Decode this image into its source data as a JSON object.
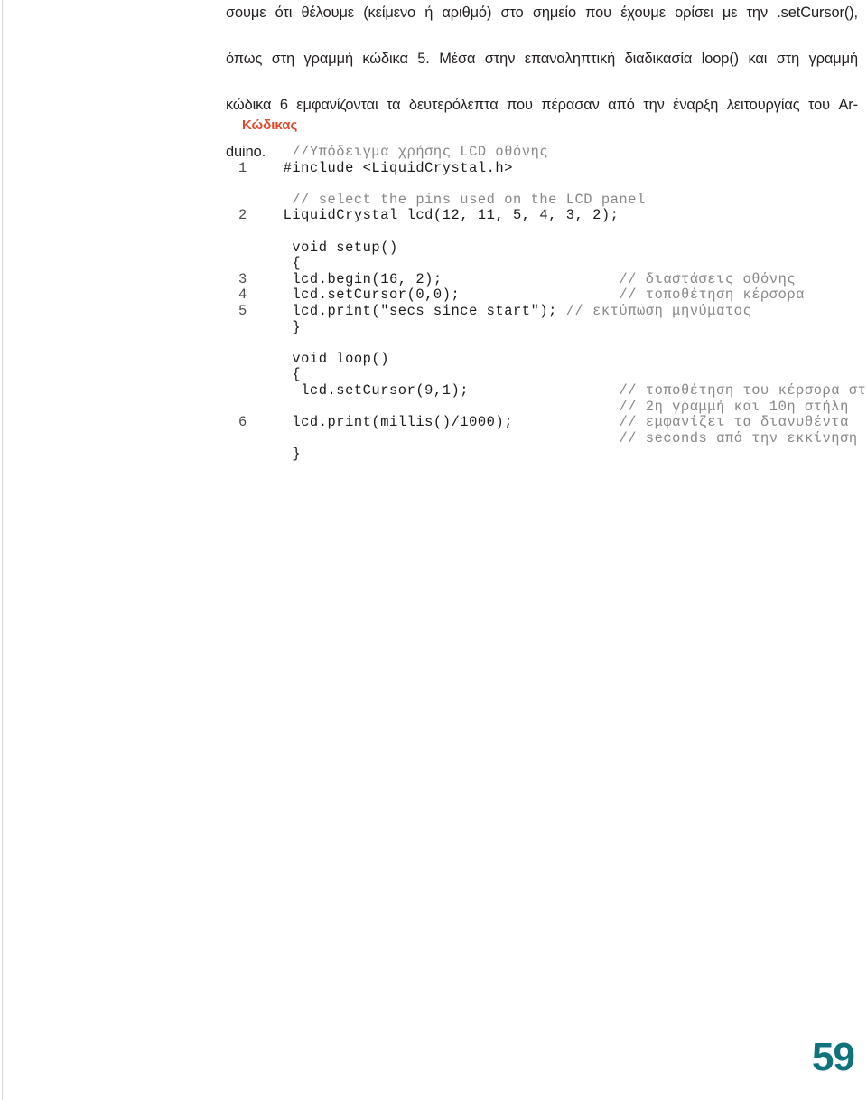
{
  "document": {
    "page_number": "59",
    "colors": {
      "heading": "#e04a2f",
      "page_number": "#10727a",
      "code": "#1a1a1a",
      "comment": "#878787",
      "body_text": "#231f20"
    }
  },
  "body": {
    "lines": [
      "σουμε ότι θέλουμε (κείμενο ή αριθμό) στο σημείο που έχουμε ορίσει με την .setCursor(),",
      "όπως στη γραμμή κώδικα 5. Μέσα στην επαναληπτική διαδικασία loop() και στη γραμμή",
      "κώδικα 6 εμφανίζονται τα δευτερόλεπτα που πέρασαν από την έναρξη λειτουργίας του Ar-",
      "duino."
    ]
  },
  "code_section": {
    "heading": "Κώδικας",
    "rows": [
      {
        "num": "",
        "code": "   //Υπόδειγμα χρήσης LCD οθόνης",
        "is_comment": true
      },
      {
        "num": "1",
        "code": "  #include <LiquidCrystal.h>",
        "is_comment": false
      },
      {
        "num": "",
        "code": "",
        "is_comment": false
      },
      {
        "num": "",
        "code": "   // select the pins used on the LCD panel",
        "is_comment": true
      },
      {
        "num": "2",
        "code": "  LiquidCrystal lcd(12, 11, 5, 4, 3, 2);",
        "is_comment": false
      },
      {
        "num": "",
        "code": "",
        "is_comment": false
      },
      {
        "num": "",
        "code": "   void setup()",
        "is_comment": false
      },
      {
        "num": "",
        "code": "   {",
        "is_comment": false
      },
      {
        "num": "3",
        "code": "   lcd.begin(16, 2);",
        "is_comment": false,
        "comment": "// διαστάσεις οθόνης",
        "comment_col": 40
      },
      {
        "num": "4",
        "code": "   lcd.setCursor(0,0);",
        "is_comment": false,
        "comment": "// τοποθέτηση κέρσορα",
        "comment_col": 40
      },
      {
        "num": "5",
        "code": "   lcd.print(\"secs since start\");",
        "is_comment": false,
        "comment": "// εκτύπωση μηνύματος",
        "comment_col": 31
      },
      {
        "num": "",
        "code": "   }",
        "is_comment": false
      },
      {
        "num": "",
        "code": "",
        "is_comment": false
      },
      {
        "num": "",
        "code": "   void loop()",
        "is_comment": false
      },
      {
        "num": "",
        "code": "   {",
        "is_comment": false
      },
      {
        "num": "",
        "code": "    lcd.setCursor(9,1);",
        "is_comment": false,
        "comment": "// τοποθέτηση του κέρσορα στη",
        "comment_col": 40
      },
      {
        "num": "",
        "code": "",
        "is_comment": false,
        "comment": "// 2η γραμμή και 10η στήλη",
        "comment_col": 40
      },
      {
        "num": "6",
        "code": "   lcd.print(millis()/1000);",
        "is_comment": false,
        "comment": "// εμφανίζει τα διανυθέντα",
        "comment_col": 40
      },
      {
        "num": "",
        "code": "",
        "is_comment": false,
        "comment": "// seconds από την εκκίνηση",
        "comment_col": 40
      },
      {
        "num": "",
        "code": "   }",
        "is_comment": false
      }
    ]
  }
}
